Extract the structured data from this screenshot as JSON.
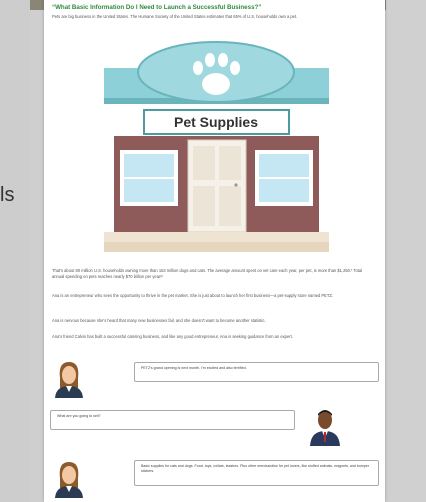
{
  "side_label": "ls",
  "heading": "“What Basic Information Do I Need to Launch a Successful Business?”",
  "intro": "Pets are big business in the United States. The Humane Society of the United States estimates that 65% of U.S. households own a pet.",
  "store_sign": "Pet Supplies",
  "paragraphs": [
    "That's about 80 million U.S. households owning more than 163 million dogs and cats. The average amount spent on vet care each year, per pet, is more than $1,250.¹ Total annual spending on pets reaches nearly $70 billion per year!²",
    "Ana is an entrepreneur who sees the opportunity to thrive in the pet market. She is just about to launch her first business—a pet-supply store named PETZ.",
    "Ana is nervous because she's heard that many new businesses fail, and she doesn't want to become another statistic.",
    "Ana's friend Calvin has built a successful catering business, and like any good entrepreneur, Ana is seeking guidance from an expert."
  ],
  "chat": [
    {
      "speaker": "Ana",
      "text": "PETZ's grand opening is next month. I'm excited and also terrified."
    },
    {
      "speaker": "Calvin",
      "text": "What are you going to sell?"
    },
    {
      "speaker": "Ana",
      "text": "Basic supplies for cats and dogs. Food, toys, collars, leashes. Plus other merchandise for pet lovers, like stuffed animals, magnets, and bumper stickers."
    }
  ],
  "colors": {
    "heading": "#2e8a3c",
    "awning": "#7fc8cf",
    "brick": "#8e5a5a",
    "sign_bg": "#ffffff",
    "window": "#bfe4f2"
  }
}
